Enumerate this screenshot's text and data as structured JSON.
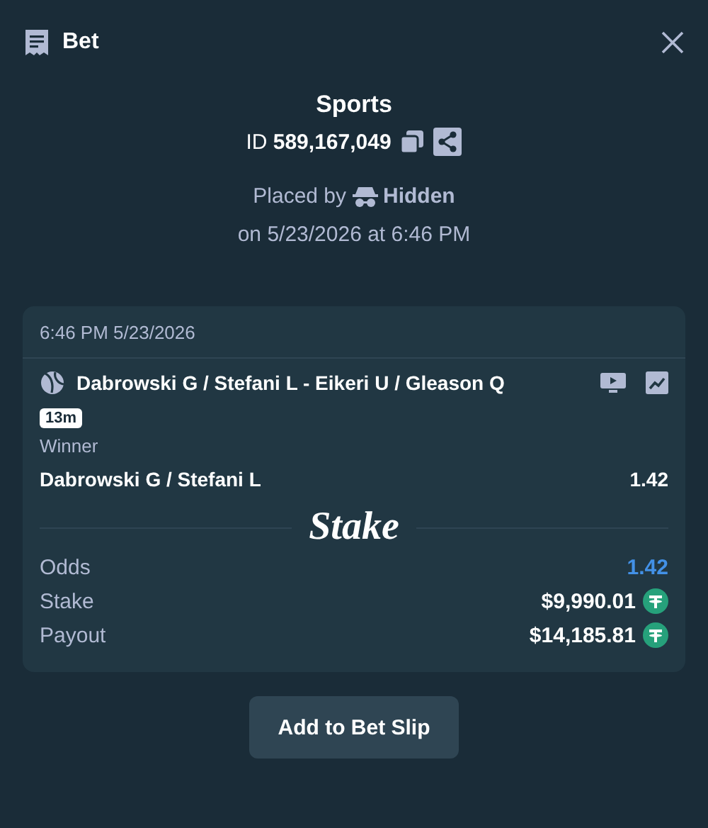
{
  "header": {
    "title": "Bet"
  },
  "summary": {
    "category": "Sports",
    "id_label": "ID",
    "id_value": "589,167,049",
    "placed_by_label": "Placed by",
    "placed_by_user": "Hidden",
    "placed_on": "on 5/23/2026 at 6:46 PM"
  },
  "card": {
    "timestamp": "6:46 PM 5/23/2026",
    "event": "Dabrowski G / Stefani L - Eikeri U / Gleason Q",
    "badge": "13m",
    "market": "Winner",
    "selection": "Dabrowski G / Stefani L",
    "selection_odds": "1.42",
    "brand": "Stake",
    "stats": [
      {
        "label": "Odds",
        "value": "1.42",
        "kind": "odds"
      },
      {
        "label": "Stake",
        "value": "$9,990.01",
        "kind": "money"
      },
      {
        "label": "Payout",
        "value": "$14,185.81",
        "kind": "money"
      }
    ]
  },
  "button": "Add to Bet Slip"
}
